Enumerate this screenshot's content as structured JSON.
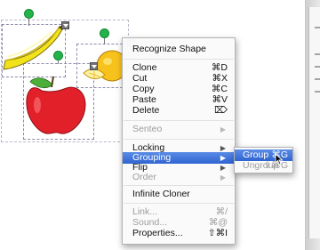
{
  "context_menu": {
    "items": [
      {
        "label": "Recognize Shape",
        "shortcut": "",
        "submenu": false,
        "disabled": false
      },
      {
        "label": "Clone",
        "shortcut": "⌘D",
        "submenu": false,
        "disabled": false
      },
      {
        "label": "Cut",
        "shortcut": "⌘X",
        "submenu": false,
        "disabled": false
      },
      {
        "label": "Copy",
        "shortcut": "⌘C",
        "submenu": false,
        "disabled": false
      },
      {
        "label": "Paste",
        "shortcut": "⌘V",
        "submenu": false,
        "disabled": false
      },
      {
        "label": "Delete",
        "shortcut": "⌦",
        "submenu": false,
        "disabled": false
      },
      {
        "label": "Senteo",
        "shortcut": "",
        "submenu": true,
        "disabled": true
      },
      {
        "label": "Locking",
        "shortcut": "",
        "submenu": true,
        "disabled": false
      },
      {
        "label": "Grouping",
        "shortcut": "",
        "submenu": true,
        "disabled": false,
        "highlighted": true
      },
      {
        "label": "Flip",
        "shortcut": "",
        "submenu": true,
        "disabled": false
      },
      {
        "label": "Order",
        "shortcut": "",
        "submenu": true,
        "disabled": true
      },
      {
        "label": "Infinite Cloner",
        "shortcut": "",
        "submenu": false,
        "disabled": false
      },
      {
        "label": "Link...",
        "shortcut": "⌘/",
        "submenu": false,
        "disabled": true
      },
      {
        "label": "Sound...",
        "shortcut": "⌘@",
        "submenu": false,
        "disabled": true
      },
      {
        "label": "Properties...",
        "shortcut": "⇧⌘I",
        "submenu": false,
        "disabled": false
      }
    ]
  },
  "grouping_submenu": {
    "items": [
      {
        "label": "Group",
        "shortcut": "⌘G",
        "highlighted": true,
        "disabled": false
      },
      {
        "label": "Ungroup",
        "shortcut": "⇧⌘G",
        "highlighted": false,
        "disabled": true
      }
    ]
  },
  "canvas_objects": {
    "shapes": [
      "banana",
      "lemon",
      "apple"
    ],
    "icons": [
      "rotate-handle-icon",
      "menu-handle-icon",
      "pointer-cursor-icon",
      "submenu-arrow-icon"
    ]
  },
  "colors": {
    "highlight": "#2f64d1",
    "rotate_handle": "#24b24a",
    "apple": "#e2202a",
    "lemon": "#f7c21c",
    "banana": "#f2e21a"
  }
}
